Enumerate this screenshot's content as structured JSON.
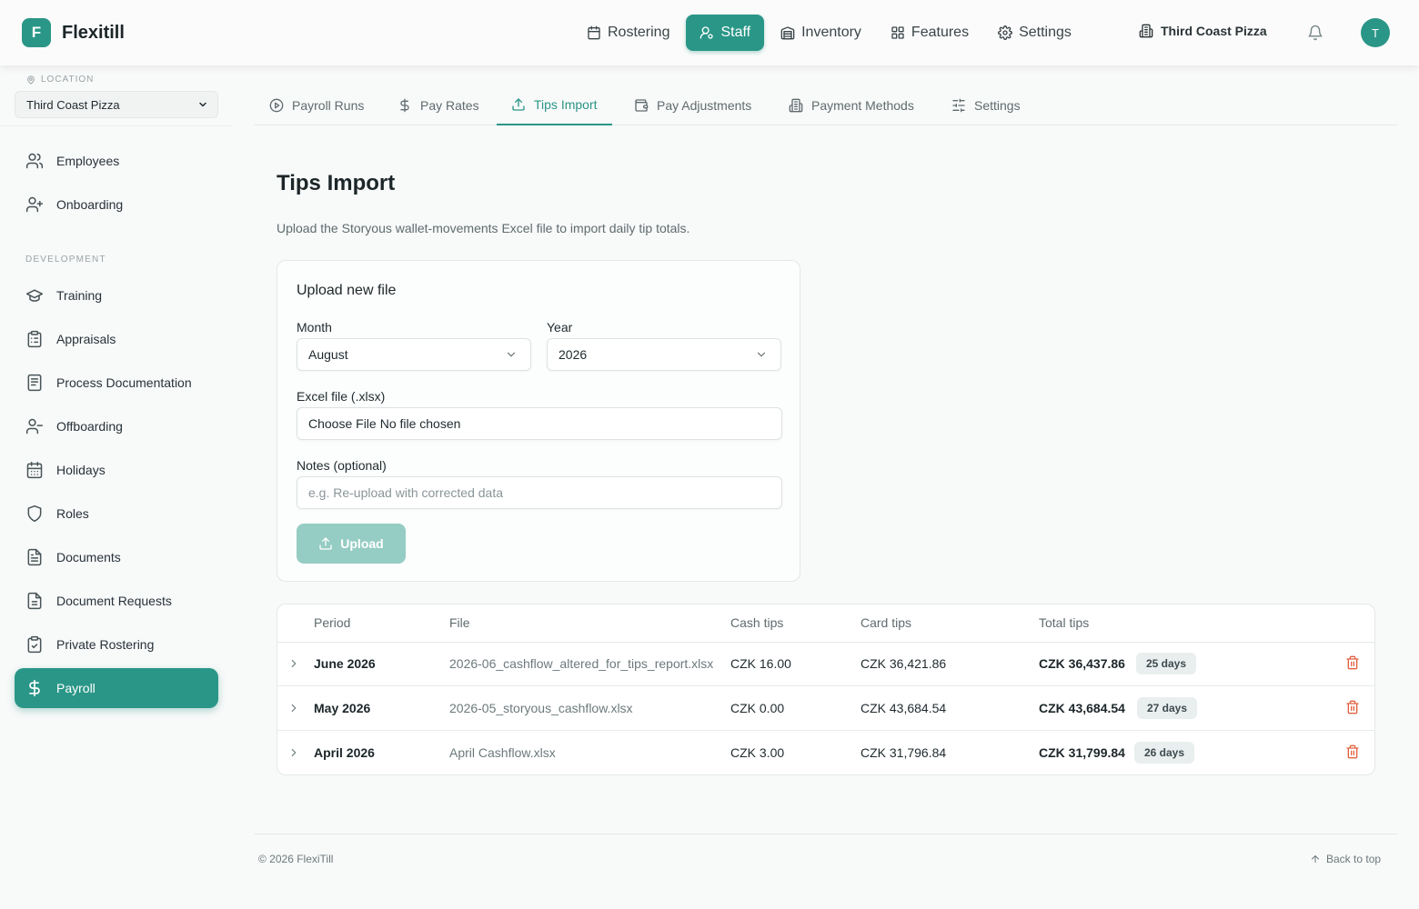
{
  "app": {
    "logo_letter": "F",
    "name": "Flexitill",
    "brand_color": "#2a9687"
  },
  "topnav": [
    {
      "label": "Rostering",
      "icon": "calendar-icon",
      "active": false
    },
    {
      "label": "Staff",
      "icon": "staff-icon",
      "active": true
    },
    {
      "label": "Inventory",
      "icon": "inventory-icon",
      "active": false
    },
    {
      "label": "Features",
      "icon": "grid-icon",
      "active": false
    },
    {
      "label": "Settings",
      "icon": "gear-icon",
      "active": false
    }
  ],
  "venue": {
    "name": "Third Coast Pizza",
    "icon": "building-icon"
  },
  "user": {
    "initial": "T"
  },
  "sidebar": {
    "location_label": "LOCATION",
    "location_value": "Third Coast Pizza",
    "section_label": "DEVELOPMENT",
    "items": [
      {
        "label": "Employees",
        "icon": "users-icon"
      },
      {
        "label": "Onboarding",
        "icon": "user-plus-icon"
      },
      {
        "label": "Training",
        "icon": "graduation-cap-icon"
      },
      {
        "label": "Appraisals",
        "icon": "clipboard-icon"
      },
      {
        "label": "Process Documentation",
        "icon": "book-icon"
      },
      {
        "label": "Offboarding",
        "icon": "user-minus-icon"
      },
      {
        "label": "Holidays",
        "icon": "calendar-days-icon"
      },
      {
        "label": "Roles",
        "icon": "shield-icon"
      },
      {
        "label": "Documents",
        "icon": "file-text-icon"
      },
      {
        "label": "Document Requests",
        "icon": "file-request-icon"
      },
      {
        "label": "Private Rostering",
        "icon": "clipboard-check-icon"
      },
      {
        "label": "Payroll",
        "icon": "dollar-icon",
        "active": true
      }
    ]
  },
  "tabs": [
    {
      "label": "Payroll Runs",
      "icon": "play-circle-icon"
    },
    {
      "label": "Pay Rates",
      "icon": "dollar-icon"
    },
    {
      "label": "Tips Import",
      "icon": "upload-icon",
      "active": true
    },
    {
      "label": "Pay Adjustments",
      "icon": "wallet-icon"
    },
    {
      "label": "Payment Methods",
      "icon": "building-icon"
    },
    {
      "label": "Settings",
      "icon": "sliders-icon"
    }
  ],
  "page": {
    "title": "Tips Import",
    "description": "Upload the Storyous wallet-movements Excel file to import daily tip totals."
  },
  "upload_form": {
    "title": "Upload new file",
    "month_label": "Month",
    "month_value": "August",
    "year_label": "Year",
    "year_value": "2026",
    "file_label": "Excel file (.xlsx)",
    "file_button": "Choose File",
    "file_status": "No file chosen",
    "notes_label": "Notes (optional)",
    "notes_placeholder": "e.g. Re-upload with corrected data",
    "upload_label": "Upload"
  },
  "imports_table": {
    "columns": [
      "Period",
      "File",
      "Cash tips",
      "Card tips",
      "Total tips"
    ],
    "rows": [
      {
        "period": "June 2026",
        "file": "2026-06_cashflow_altered_for_tips_report.xlsx",
        "cash": "CZK 16.00",
        "card": "CZK 36,421.86",
        "total": "CZK 36,437.86",
        "days": "25 days"
      },
      {
        "period": "May 2026",
        "file": "2026-05_storyous_cashflow.xlsx",
        "cash": "CZK 0.00",
        "card": "CZK 43,684.54",
        "total": "CZK 43,684.54",
        "days": "27 days"
      },
      {
        "period": "April 2026",
        "file": "April Cashflow.xlsx",
        "cash": "CZK 3.00",
        "card": "CZK 31,796.84",
        "total": "CZK 31,799.84",
        "days": "26 days"
      }
    ]
  },
  "footer": {
    "copyright": "© 2026 FlexiTill",
    "back_to_top": "Back to top"
  }
}
